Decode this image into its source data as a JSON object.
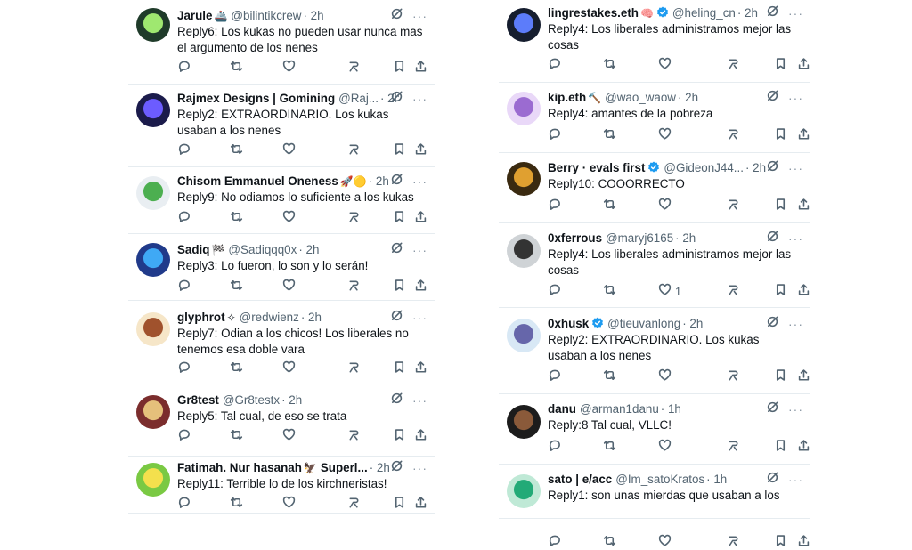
{
  "left": [
    {
      "name": "Jarule",
      "badge": "🚢",
      "verified": false,
      "handle": "@bilintikcrew",
      "time": "· 2h",
      "text": "Reply6: Los kukas no pueden usar nunca mas el argumento de los nenes",
      "likes": ""
    },
    {
      "name": "Rajmex Designs | Gomining",
      "badge": "",
      "verified": false,
      "handle": "@Raj...",
      "time": "· 2h",
      "text": "Reply2: EXTRAORDINARIO. Los kukas usaban a los nenes",
      "likes": ""
    },
    {
      "name": "Chisom Emmanuel Oneness",
      "badge": "🚀🟡",
      "verified": false,
      "handle": "",
      "time": "· 2h",
      "text": "Reply9: No odiamos lo suficiente a los kukas",
      "likes": ""
    },
    {
      "name": "Sadiq",
      "badge": "🏁",
      "verified": false,
      "handle": "@Sadiqqq0x",
      "time": "· 2h",
      "text": "Reply3: Lo fueron, lo son y lo serán!",
      "likes": ""
    },
    {
      "name": "glyphrot",
      "badge": "✧",
      "verified": false,
      "handle": "@redwienz",
      "time": "· 2h",
      "text": "Reply7: Odian a los chicos! Los liberales no tenemos esa doble vara",
      "likes": ""
    },
    {
      "name": "Gr8test",
      "badge": "",
      "verified": false,
      "handle": "@Gr8testx",
      "time": "· 2h",
      "text": "Reply5: Tal cual, de eso se trata",
      "likes": ""
    },
    {
      "name": "Fatimah. Nur hasanah",
      "badge": "🦅",
      "name_suffix": "Superl...",
      "verified": false,
      "handle": "",
      "time": "· 2h",
      "text": "Reply11: Terrible lo de los kirchneristas!",
      "likes": ""
    }
  ],
  "right": [
    {
      "name": "lingrestakes.eth",
      "badge": "🧠",
      "verified": true,
      "handle": "@heling_cn",
      "time": "· 2h",
      "text": "Reply4: Los liberales administramos mejor las cosas",
      "likes": ""
    },
    {
      "name": "kip.eth",
      "badge": "🔨",
      "verified": false,
      "handle": "@wao_waow",
      "time": "· 2h",
      "text": "Reply4: amantes de la pobreza",
      "likes": ""
    },
    {
      "name": "Berry · evals first",
      "badge": "",
      "verified": true,
      "handle": "@GideonJ44...",
      "time": "· 2h",
      "text": "Reply10: COOORRECTO",
      "likes": ""
    },
    {
      "name": "0xferrous",
      "badge": "",
      "verified": false,
      "handle": "@maryj6165",
      "time": "· 2h",
      "text": "Reply4: Los liberales administramos mejor las cosas",
      "likes": "1"
    },
    {
      "name": "0xhusk",
      "badge": "",
      "verified": true,
      "handle": "@tieuvanlong",
      "time": "· 2h",
      "text": "Reply2: EXTRAORDINARIO. Los kukas usaban a los nenes",
      "likes": ""
    },
    {
      "name": "danu",
      "badge": "",
      "verified": false,
      "handle": "@arman1danu",
      "time": "· 1h",
      "text": "Reply:8 Tal cual, VLLC!",
      "likes": ""
    },
    {
      "name": "sato | e/acc",
      "badge": "",
      "verified": false,
      "handle": "@Im_satoKratos",
      "time": "· 1h",
      "text": "Reply1: son unas mierdas que usaban a los",
      "likes": ""
    }
  ],
  "colors": {
    "text": "#0f1419",
    "muted": "#536471",
    "divider": "#e6ecf0",
    "verified": "#1d9bf0"
  },
  "icons": [
    "grok-icon",
    "more-icon",
    "reply-icon",
    "retweet-icon",
    "like-icon",
    "views-icon",
    "bookmark-icon",
    "share-icon",
    "verified-icon"
  ]
}
